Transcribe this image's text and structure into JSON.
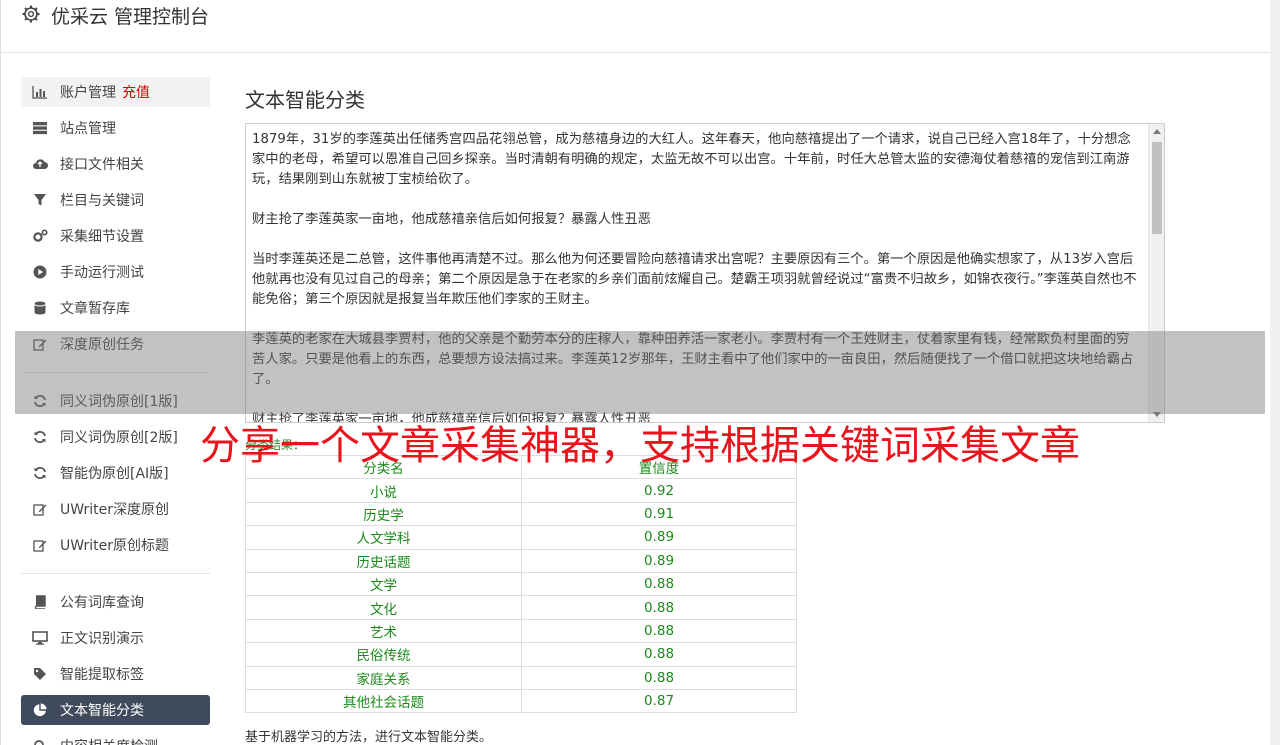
{
  "header": {
    "title": "优采云 管理控制台"
  },
  "sidebar": {
    "items": [
      {
        "label": "账户管理",
        "extra": "充值",
        "icon": "bar-chart-icon"
      },
      {
        "label": "站点管理",
        "icon": "server-icon"
      },
      {
        "label": "接口文件相关",
        "icon": "cloud-upload-icon"
      },
      {
        "label": "栏目与关键词",
        "icon": "filter-icon"
      },
      {
        "label": "采集细节设置",
        "icon": "gears-icon"
      },
      {
        "label": "手动运行测试",
        "icon": "play-icon"
      },
      {
        "label": "文章暂存库",
        "icon": "database-icon"
      },
      {
        "label": "深度原创任务",
        "icon": "edit-icon"
      },
      {
        "label": "同义词伪原创[1版]",
        "icon": "refresh-icon"
      },
      {
        "label": "同义词伪原创[2版]",
        "icon": "refresh-icon"
      },
      {
        "label": "智能伪原创[AI版]",
        "icon": "refresh-icon"
      },
      {
        "label": "UWriter深度原创",
        "icon": "edit-icon"
      },
      {
        "label": "UWriter原创标题",
        "icon": "edit-icon"
      },
      {
        "label": "公有词库查询",
        "icon": "book-icon"
      },
      {
        "label": "正文识别演示",
        "icon": "monitor-icon"
      },
      {
        "label": "智能提取标签",
        "icon": "tag-icon"
      },
      {
        "label": "文本智能分类",
        "icon": "pie-chart-icon"
      },
      {
        "label": "内容相关度检测",
        "icon": "search-icon"
      }
    ]
  },
  "main": {
    "title": "文本智能分类",
    "text_content": "1879年，31岁的李莲英出任储秀宫四品花翎总管，成为慈禧身边的大红人。这年春天，他向慈禧提出了一个请求，说自己已经入宫18年了，十分想念家中的老母，希望可以恩准自己回乡探亲。当时清朝有明确的规定，太监无故不可以出宫。十年前，时任大总管太监的安德海仗着慈禧的宠信到江南游玩，结果刚到山东就被丁宝桢给砍了。\n\n财主抢了李莲英家一亩地，他成慈禧亲信后如何报复？暴露人性丑恶\n\n当时李莲英还是二总管，这件事他再清楚不过。那么他为何还要冒险向慈禧请求出宫呢？主要原因有三个。第一个原因是他确实想家了，从13岁入宫后他就再也没有见过自己的母亲；第二个原因是急于在老家的乡亲们面前炫耀自己。楚霸王项羽就曾经说过“富贵不归故乡，如锦衣夜行。”李莲英自然也不能免俗；第三个原因就是报复当年欺压他们李家的王财主。\n\n李莲英的老家在大城县李贾村，他的父亲是个勤劳本分的庄稼人，靠种田养活一家老小。李贾村有一个王姓财主，仗着家里有钱，经常欺负村里面的穷苦人家。只要是他看上的东西，总要想方设法搞过来。李莲英12岁那年，王财主看中了他们家中的一亩良田，然后随便找了一个借口就把这块地给霸占了。\n\n财主抢了李莲英家一亩地，他成慈禧亲信后如何报复？暴露人性丑恶",
    "result_label": "分类结果：",
    "table": {
      "headers": [
        "分类名",
        "置信度"
      ],
      "rows": [
        [
          "小说",
          "0.92"
        ],
        [
          "历史学",
          "0.91"
        ],
        [
          "人文学科",
          "0.89"
        ],
        [
          "历史话题",
          "0.89"
        ],
        [
          "文学",
          "0.88"
        ],
        [
          "文化",
          "0.88"
        ],
        [
          "艺术",
          "0.88"
        ],
        [
          "民俗传统",
          "0.88"
        ],
        [
          "家庭关系",
          "0.88"
        ],
        [
          "其他社会话题",
          "0.87"
        ]
      ]
    },
    "footnote": "基于机器学习的方法，进行文本智能分类。"
  },
  "overlay": {
    "caption": "分享一个文章采集神器，支持根据关键词采集文章"
  },
  "colors": {
    "active_nav_bg": "#3f4a5c",
    "result_green": "#1a8a1a",
    "caption_red": "#e8141c",
    "recharge_red": "#dd0000"
  }
}
